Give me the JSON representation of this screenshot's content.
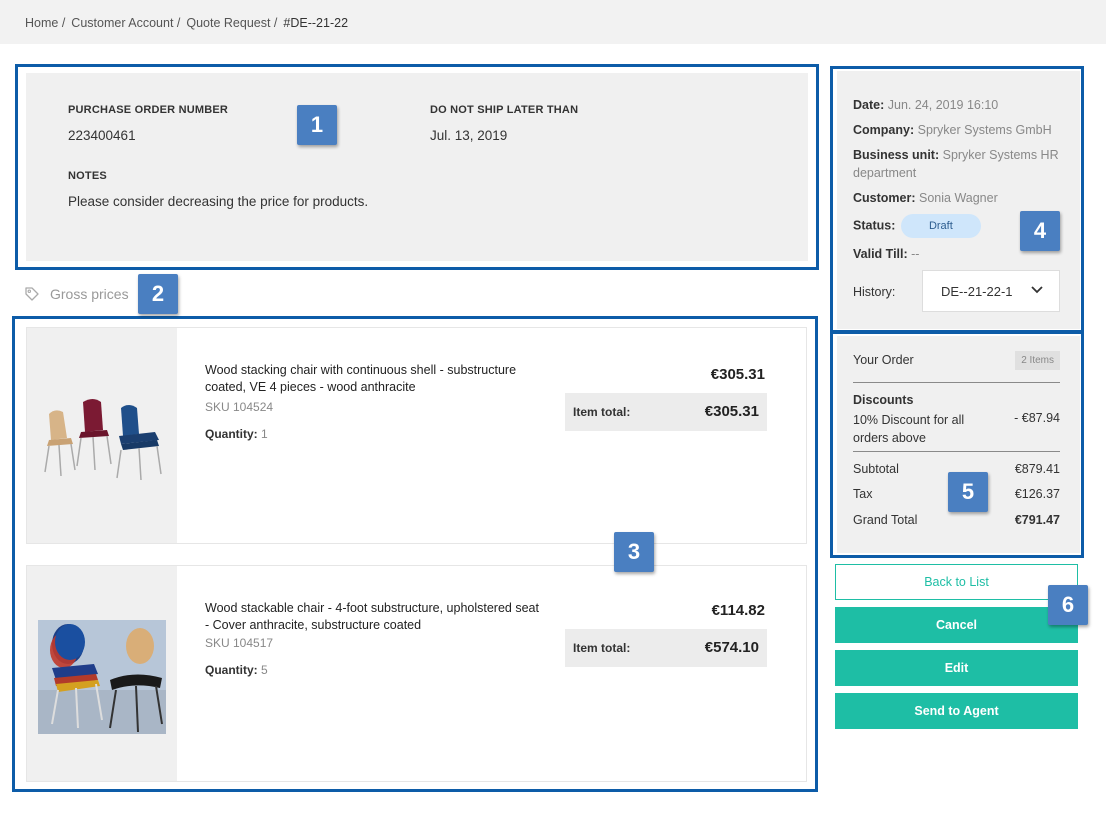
{
  "breadcrumb": [
    {
      "label": "Home /"
    },
    {
      "label": "Customer Account /"
    },
    {
      "label": "Quote Request /"
    },
    {
      "label": "#DE--21-22"
    }
  ],
  "info": {
    "po_label": "PURCHASE ORDER NUMBER",
    "po_value": "223400461",
    "ship_label": "DO NOT SHIP LATER THAN",
    "ship_value": "Jul. 13, 2019",
    "notes_label": "NOTES",
    "notes_value": "Please consider decreasing the price for products."
  },
  "gross_prices": "Gross prices",
  "items": [
    {
      "title": "Wood stacking chair with continuous shell - substructure coated, VE 4 pieces - wood anthracite",
      "sku": "SKU 104524",
      "qty_label": "Quantity:",
      "qty_value": "1",
      "price": "€305.31",
      "total_label": "Item total:",
      "total_value": "€305.31"
    },
    {
      "title": "Wood stackable chair - 4-foot substructure, upholstered seat - Cover anthracite, substructure coated",
      "sku": "SKU 104517",
      "qty_label": "Quantity:",
      "qty_value": "5",
      "price": "€114.82",
      "total_label": "Item total:",
      "total_value": "€574.10"
    }
  ],
  "meta": {
    "date_label": "Date:",
    "date_value": "Jun. 24, 2019 16:10",
    "company_label": "Company:",
    "company_value": "Spryker Systems GmbH",
    "bu_label": "Business unit:",
    "bu_value": "Spryker Systems HR department",
    "customer_label": "Customer:",
    "customer_value": "Sonia Wagner",
    "status_label": "Status:",
    "status_value": "Draft",
    "valid_label": "Valid Till:",
    "valid_value": "--",
    "history_label": "History:",
    "history_value": "DE--21-22-1"
  },
  "order": {
    "title": "Your Order",
    "items_count": "2 Items",
    "discounts_label": "Discounts",
    "discount_name": "10% Discount for all orders above",
    "discount_value": "- €87.94",
    "subtotal_label": "Subtotal",
    "subtotal_value": "€879.41",
    "tax_label": "Tax",
    "tax_value": "€126.37",
    "grand_label": "Grand Total",
    "grand_value": "€791.47"
  },
  "actions": {
    "back": "Back to List",
    "cancel": "Cancel",
    "edit": "Edit",
    "send": "Send to Agent"
  },
  "annotations": [
    "1",
    "2",
    "3",
    "4",
    "5",
    "6"
  ],
  "colors": {
    "accent": "#1ebea5",
    "annotation_border": "#0d5ca8",
    "annotation_badge": "#4a7fc1",
    "status_pill": "#cfe6fb"
  }
}
